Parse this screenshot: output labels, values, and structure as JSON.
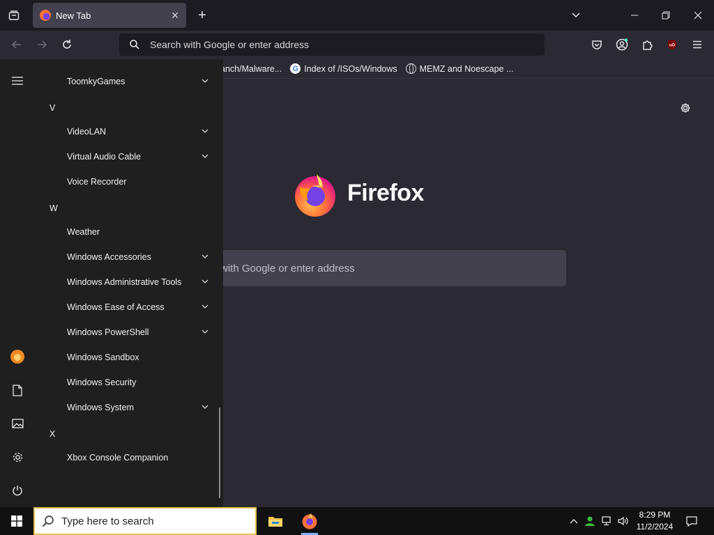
{
  "browser": {
    "tab_title": "New Tab",
    "url_placeholder": "Search with Google or enter address",
    "bookmarks": [
      {
        "label": "anch/Malware...",
        "icon": "none"
      },
      {
        "label": "Index of /ISOs/Windows",
        "icon": "google-icon"
      },
      {
        "label": "MEMZ and Noescape ...",
        "icon": "globe-icon"
      }
    ],
    "logo_word": "Firefox",
    "content_search_placeholder": "with Google or enter address"
  },
  "start_menu": {
    "entries": [
      {
        "type": "item",
        "label": "ToomkyGames",
        "expandable": true
      },
      {
        "type": "letter",
        "label": "V"
      },
      {
        "type": "item",
        "label": "VideoLAN",
        "expandable": true
      },
      {
        "type": "item",
        "label": "Virtual Audio Cable",
        "expandable": true
      },
      {
        "type": "item",
        "label": "Voice Recorder",
        "expandable": false
      },
      {
        "type": "letter",
        "label": "W"
      },
      {
        "type": "item",
        "label": "Weather",
        "expandable": false
      },
      {
        "type": "item",
        "label": "Windows Accessories",
        "expandable": true
      },
      {
        "type": "item",
        "label": "Windows Administrative Tools",
        "expandable": true
      },
      {
        "type": "item",
        "label": "Windows Ease of Access",
        "expandable": true
      },
      {
        "type": "item",
        "label": "Windows PowerShell",
        "expandable": true
      },
      {
        "type": "item",
        "label": "Windows Sandbox",
        "expandable": false
      },
      {
        "type": "item",
        "label": "Windows Security",
        "expandable": false
      },
      {
        "type": "item",
        "label": "Windows System",
        "expandable": true
      },
      {
        "type": "letter",
        "label": "X"
      },
      {
        "type": "item",
        "label": "Xbox Console Companion",
        "expandable": false
      }
    ]
  },
  "taskbar": {
    "search_placeholder": "Type here to search",
    "time": "8:29 PM",
    "date": "11/2/2024"
  },
  "colors": {
    "accent": "#7542e5",
    "firefox_orange": "#ff7139",
    "search_border": "#e3c14b"
  }
}
